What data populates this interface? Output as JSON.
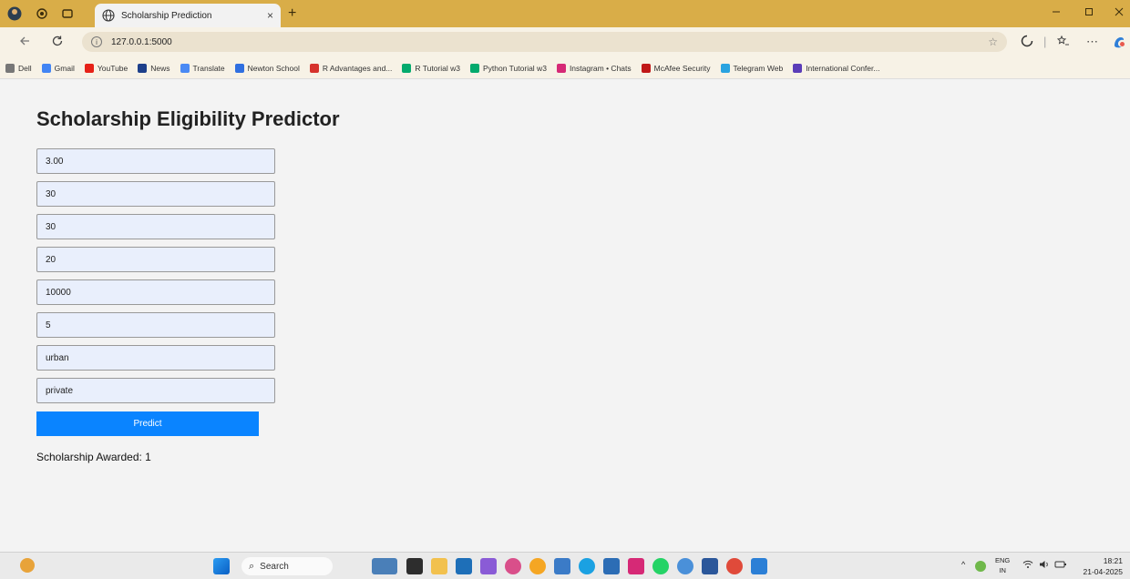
{
  "browser": {
    "tab_title": "Scholarship Prediction",
    "tab_close": "×",
    "new_tab": "+",
    "url": "127.0.0.1:5000",
    "bookmarks": [
      {
        "label": "Dell",
        "icon": "folder-icon",
        "color": "#777777"
      },
      {
        "label": "Gmail",
        "icon": "google-icon",
        "color": "#4285f4"
      },
      {
        "label": "YouTube",
        "icon": "youtube-icon",
        "color": "#e62117"
      },
      {
        "label": "News",
        "icon": "news-icon",
        "color": "#1d3f8a"
      },
      {
        "label": "Translate",
        "icon": "translate-icon",
        "color": "#4a8af4"
      },
      {
        "label": "Newton School",
        "icon": "newton-icon",
        "color": "#2f6fe0"
      },
      {
        "label": "R Advantages and...",
        "icon": "vivaldi-icon",
        "color": "#d6322c"
      },
      {
        "label": "R Tutorial w3",
        "icon": "w3-icon",
        "color": "#04aa6d"
      },
      {
        "label": "Python Tutorial w3",
        "icon": "w3-icon",
        "color": "#04aa6d"
      },
      {
        "label": "Instagram • Chats",
        "icon": "instagram-icon",
        "color": "#d62976"
      },
      {
        "label": "McAfee Security",
        "icon": "mcafee-icon",
        "color": "#c01818"
      },
      {
        "label": "Telegram Web",
        "icon": "telegram-icon",
        "color": "#2aa3e0"
      },
      {
        "label": "International Confer...",
        "icon": "conference-icon",
        "color": "#5b3db8"
      }
    ]
  },
  "page": {
    "title": "Scholarship Eligibility Predictor",
    "fields": [
      "3.00",
      "30",
      "30",
      "20",
      "10000",
      "5",
      "urban",
      "private"
    ],
    "predict_label": "Predict",
    "result": "Scholarship Awarded: 1"
  },
  "taskbar": {
    "search_label": "Search",
    "language": "ENG",
    "region": "IN",
    "time": "18:21",
    "date": "21-04-2025"
  }
}
